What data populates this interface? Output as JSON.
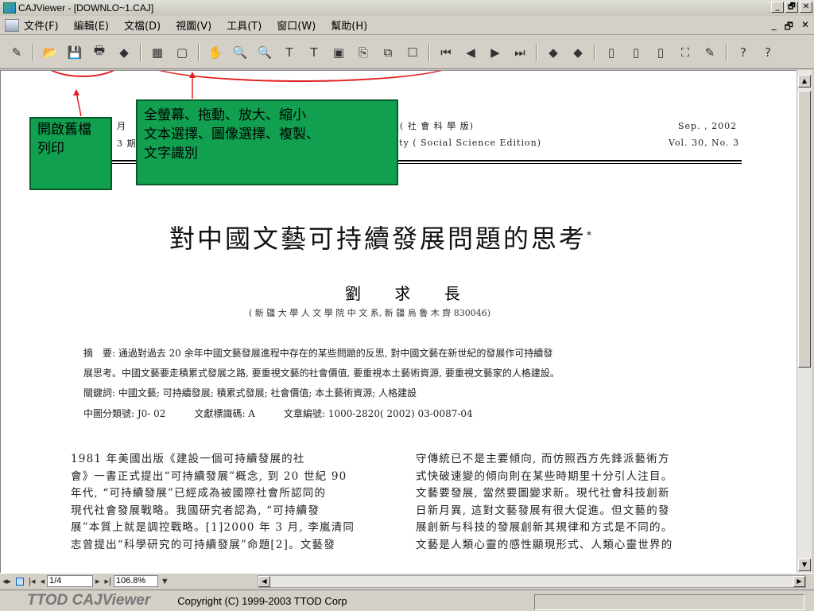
{
  "window": {
    "title": "CAJViewer - [DOWNLO~1.CAJ]",
    "controls": [
      "_",
      "🗗",
      "✕"
    ]
  },
  "menu": {
    "items": [
      "文件(F)",
      "編輯(E)",
      "文檔(D)",
      "視圖(V)",
      "工具(T)",
      "窗口(W)",
      "幫助(H)"
    ],
    "mdi": [
      "_",
      "🗗",
      "✕"
    ]
  },
  "toolbar": {
    "icons": [
      "tool-icon",
      "open-folder-icon",
      "save-icon",
      "print-icon",
      "back-icon",
      "fullscreen-icon",
      "window-icon",
      "hand-icon",
      "zoom-in-icon",
      "zoom-out-icon",
      "text-select-icon",
      "text-edit-icon",
      "image-select-icon",
      "copy-icon",
      "ocr-icon",
      "properties-icon",
      "first-page-icon",
      "prev-page-icon",
      "next-page-icon",
      "last-page-icon",
      "back-arrow-icon",
      "forward-arrow-icon",
      "single-page-icon",
      "double-page-icon",
      "continuous-icon",
      "binoculars-icon",
      "highlight-icon",
      "help-icon",
      "question-icon"
    ],
    "glyphs": [
      "✎",
      "📂",
      "💾",
      "🖶",
      "◆",
      "▦",
      "▢",
      "✋",
      "🔍",
      "🔍",
      "T",
      "T",
      "▣",
      "⎘",
      "⧉",
      "☐",
      "⏮",
      "◀",
      "▶",
      "⏭",
      "◆",
      "◆",
      "▯",
      "▯",
      "▯",
      "⛶",
      "✎",
      "?",
      "?"
    ]
  },
  "page": {
    "journal_left_1": "月",
    "journal_left_2": "3 期",
    "journal_cn": "報( 社 會 科 學 版)",
    "journal_en": "sity ( Social Science Edition)",
    "date": "Sep. , 2002",
    "vol": "Vol. 30, No. 3",
    "title": "對中國文藝可持續發展問題的思考",
    "title_mark": "*",
    "author": "劉 求 長",
    "affil": "( 新 疆 大 學  人 文 學 院 中 文 系,  新 疆  烏 魯 木 齊  830046)",
    "abstract_1": "摘　要:  通過對過去 20 余年中國文藝發展進程中存在的某些問題的反思, 對中國文藝在新世紀的發展作可持續發",
    "abstract_2": "展思考。中國文藝要走積累式發展之路, 要重視文藝的社會價值, 要重視本土藝術資源, 要重視文藝家的人格建設。",
    "keywords": "關鍵詞:  中國文藝;  可持續發展;  積累式發展;  社會價值;  本土藝術資源;  人格建設",
    "classification": "中圖分類號:  J0- 02　　　文獻標識碼:  A　　　文章編號:  1000-2820( 2002) 03-0087-04",
    "col_left": [
      "1981 年美國出版《建設一個可持續發展的社",
      "會》一書正式提出“可持續發展”概念, 到 20 世紀 90",
      "年代, “可持續發展”已經成為被國際社會所認同的",
      "現代社會發展戰略。我國研究者認為, “可持續發",
      "展”本質上就是調控戰略。[1]2000 年 3 月, 李嵐清同",
      "志曾提出“科學研究的可持續發展”命題[2]。文藝發"
    ],
    "col_right": [
      "守傳統已不是主要傾向, 而仿照西方先鋒派藝術方",
      "式快破速變的傾向則在某些時期里十分引人注目。",
      "文藝要發展, 當然要圖變求新。現代社會科技創新",
      "日新月異, 這對文藝發展有很大促進。但文藝的發",
      "展創新与科技的發展創新其規律和方式是不同的。",
      "文藝是人類心靈的感性顯現形式、人類心靈世界的"
    ]
  },
  "annotations": {
    "callout_left": [
      "開啟舊檔",
      "列印"
    ],
    "callout_right": [
      "全螢幕、拖動、放大、縮小",
      "文本選擇、圖像選擇、複製、",
      "文字識別"
    ]
  },
  "nav": {
    "page": "1/4",
    "zoom": "106.8%"
  },
  "status": {
    "brand": "TTOD CAJViewer",
    "copyright": "Copyright (C) 1999-2003 TTOD Corp"
  },
  "colors": {
    "callout": "#10a050",
    "oval": "#e02020"
  }
}
